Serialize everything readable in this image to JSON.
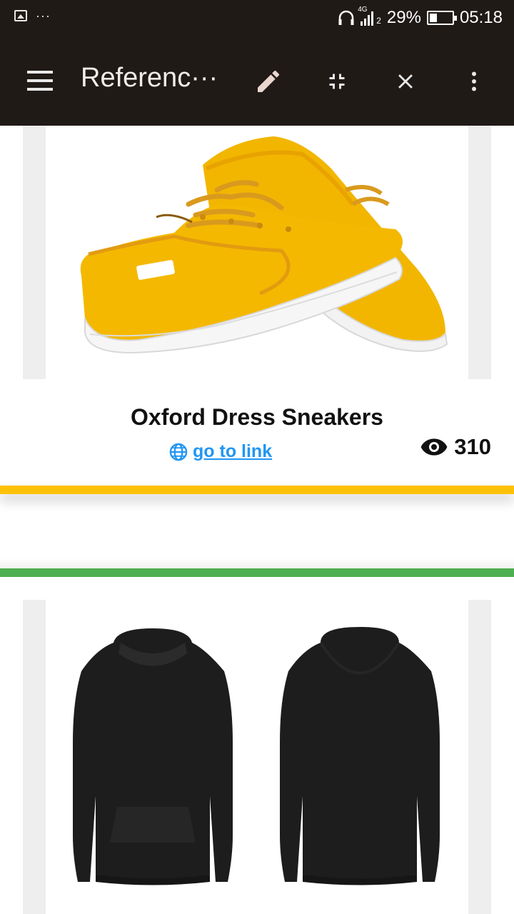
{
  "status_bar": {
    "network": "4G",
    "sim_slot": "2",
    "battery_percent": "29%",
    "battery_level": 0.29,
    "time": "05:18",
    "overflow": "···"
  },
  "app_bar": {
    "title": "Referenc···",
    "icons": [
      "menu-icon",
      "edit-icon",
      "collapse-icon",
      "close-icon",
      "more-vertical-icon"
    ]
  },
  "items": [
    {
      "title": "Oxford Dress Sneakers",
      "link_label": "go to link",
      "views": "310",
      "accent_color": "#ffc107",
      "image": "yellow-sneakers"
    },
    {
      "accent_color": "#4caf50",
      "image": "black-hoodie-front-back"
    }
  ]
}
